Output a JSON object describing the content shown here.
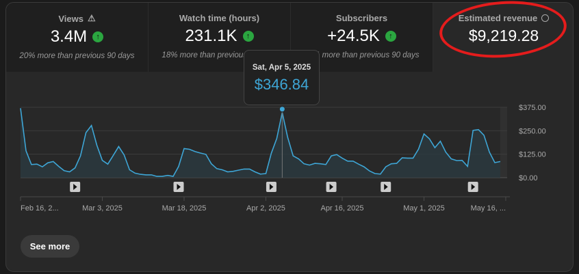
{
  "metrics": [
    {
      "label": "Views",
      "icon": "warning-icon",
      "value": "3.4M",
      "trend": "up",
      "sub": "20% more than previous 90 days"
    },
    {
      "label": "Watch time (hours)",
      "value": "231.1K",
      "trend": "up",
      "sub": "18% more than previous 90 days"
    },
    {
      "label": "Subscribers",
      "value": "+24.5K",
      "trend": "up",
      "sub": "20% more than previous 90 days"
    },
    {
      "label": "Estimated revenue",
      "icon": "clock-icon",
      "value": "$9,219.28",
      "selected": true
    }
  ],
  "tooltip": {
    "date": "Sat, Apr 5, 2025",
    "value": "$346.84"
  },
  "see_more": "See more",
  "colors": {
    "line": "#3ea6d6",
    "up": "#2ba640",
    "annotation": "#e41c1c"
  },
  "chart_data": {
    "type": "area",
    "x_start": "2025-02-16",
    "ylim": [
      0,
      375
    ],
    "y_ticks": [
      "$0.00",
      "$125.00",
      "$250.00",
      "$375.00"
    ],
    "y_tick_values": [
      0,
      125,
      250,
      375
    ],
    "x_ticks": [
      {
        "label": "Feb 16, 2...",
        "day": 0
      },
      {
        "label": "Mar 3, 2025",
        "day": 15
      },
      {
        "label": "Mar 18, 2025",
        "day": 30
      },
      {
        "label": "Apr 2, 2025",
        "day": 45
      },
      {
        "label": "Apr 16, 2025",
        "day": 59
      },
      {
        "label": "May 1, 2025",
        "day": 74
      },
      {
        "label": "May 16, ...",
        "day": 89
      }
    ],
    "values": [
      370,
      143,
      70,
      72,
      58,
      79,
      86,
      60,
      37,
      31,
      52,
      116,
      240,
      278,
      173,
      92,
      72,
      118,
      166,
      121,
      42,
      24,
      18,
      15,
      15,
      7,
      7,
      12,
      7,
      60,
      155,
      151,
      139,
      131,
      124,
      74,
      48,
      42,
      31,
      34,
      40,
      46,
      46,
      31,
      19,
      22,
      130,
      209,
      346.84,
      215,
      116,
      100,
      74,
      67,
      76,
      74,
      70,
      116,
      123,
      104,
      88,
      88,
      72,
      58,
      36,
      22,
      19,
      58,
      74,
      76,
      106,
      104,
      104,
      152,
      233,
      207,
      160,
      194,
      136,
      100,
      91,
      92,
      60,
      252,
      256,
      226,
      136,
      80,
      86
    ],
    "highlight_day": 48,
    "video_markers_days": [
      10,
      29,
      46,
      57,
      67,
      83
    ],
    "grid": true
  }
}
